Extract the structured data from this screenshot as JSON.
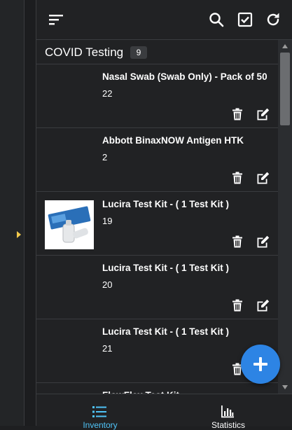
{
  "colors": {
    "accent": "#2d84e4",
    "active_tab": "#4fc3f7",
    "expand_arrow": "#f2c94c"
  },
  "toolbar": {
    "menu_icon": "sort-lines-icon",
    "search_icon": "search-icon",
    "select_icon": "checkbox-checked-icon",
    "refresh_icon": "refresh-icon"
  },
  "section": {
    "title": "COVID Testing",
    "count": "9"
  },
  "items": [
    {
      "name": "Nasal Swab (Swab Only) - Pack of 50",
      "qty": "22",
      "has_image": false
    },
    {
      "name": "Abbott BinaxNOW Antigen HTK",
      "qty": "2",
      "has_image": false
    },
    {
      "name": "Lucira Test Kit - ( 1 Test Kit )",
      "qty": "19",
      "has_image": true
    },
    {
      "name": "Lucira Test Kit - ( 1 Test Kit )",
      "qty": "20",
      "has_image": false
    },
    {
      "name": "Lucira Test Kit - ( 1 Test Kit )",
      "qty": "21",
      "has_image": false
    },
    {
      "name": "FlowFlex Test Kit",
      "qty": "",
      "has_image": false
    }
  ],
  "item_actions": {
    "delete_icon": "trash-icon",
    "edit_icon": "edit-icon"
  },
  "fab": {
    "icon": "plus-icon"
  },
  "bottom_nav": {
    "tabs": [
      {
        "label": "Inventory",
        "icon": "list-icon",
        "active": true
      },
      {
        "label": "Statistics",
        "icon": "bar-chart-icon",
        "active": false
      }
    ]
  }
}
